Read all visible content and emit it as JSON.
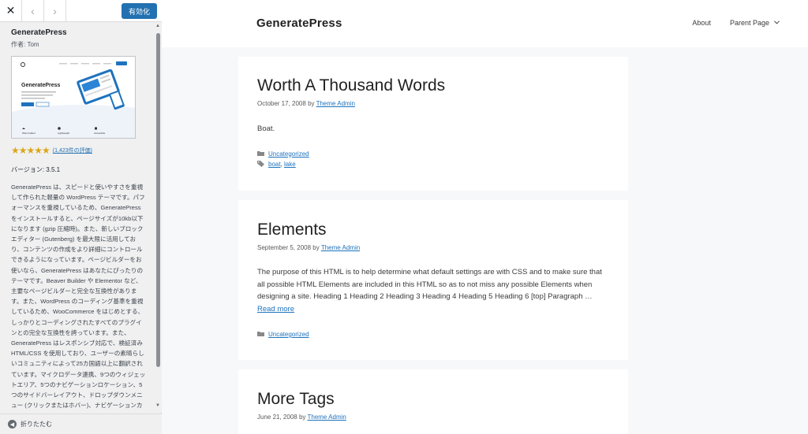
{
  "sidebar": {
    "activate_label": "有効化",
    "theme_name": "GeneratePress",
    "author": "作者: Tom",
    "screenshot": {
      "brand": "GeneratePress",
      "features": [
        "Well-Crafted",
        "Lightweight",
        "Accessible"
      ]
    },
    "rating_stars": "★★★★★",
    "rating_link": "(1,423件の評価)",
    "version": "バージョン: 3.5.1",
    "description": "GeneratePress は、スピードと使いやすさを重視して作られた軽量の WordPress テーマです。パフォーマンスを重視しているため、GeneratePress をインストールすると、ページサイズが10kb以下になります (gzip 圧縮時)。また、新しいブロックエディター (Gutenberg) を最大限に活用しており、コンテンツの作成をより詳細にコントロールできるようになっています。ページビルダーをお使いなら、GeneratePress はあなたにぴったりのテーマです。Beaver Builder や Elementor など、主要なページビルダーと完全な互換性があります。また、WordPress のコーディング基準を重視しているため、WooCommerce をはじめとする、しっかりとコーディングされたすべてのプラグインとの完全な互換性を誇っています。また、GeneratePress はレスポンシブ対応で、検証済み HTML/CSS を使用しており、ユーザーの素晴らしいコミュニティによって25カ国語以上に翻訳されています。マイクロデータ連携、9つのウィジェットエリア、5つのナビゲーションロケーション、5つのサイドバーレイアウト、ドロップダウンメニュー (クリックまたはホバー)、ナビゲーションカラープリセットなど、多くの機能を",
    "collapse_label": "折りたたむ"
  },
  "site": {
    "title": "GeneratePress",
    "nav": {
      "about": "About",
      "parent_page": "Parent Page"
    }
  },
  "posts": [
    {
      "title": "Worth A Thousand Words",
      "date": "October 17, 2008",
      "by": "by",
      "author": "Theme Admin",
      "body": "Boat.",
      "category": "Uncategorized",
      "tags": [
        "boat",
        "lake"
      ]
    },
    {
      "title": "Elements",
      "date": "September 5, 2008",
      "by": "by",
      "author": "Theme Admin",
      "body": "The purpose of this HTML is to help determine what default settings are with CSS and to make sure that all possible HTML Elements are included in this HTML so as to not miss any possible Elements when designing a site. Heading 1 Heading 2 Heading 3 Heading 4 Heading 5 Heading 6 [top] Paragraph …",
      "read_more": "Read more",
      "category": "Uncategorized"
    },
    {
      "title": "More Tags",
      "date": "June 21, 2008",
      "by": "by",
      "author": "Theme Admin"
    }
  ],
  "colors": {
    "accent": "#2271b1",
    "link": "#1e73be",
    "star": "#dba617"
  }
}
